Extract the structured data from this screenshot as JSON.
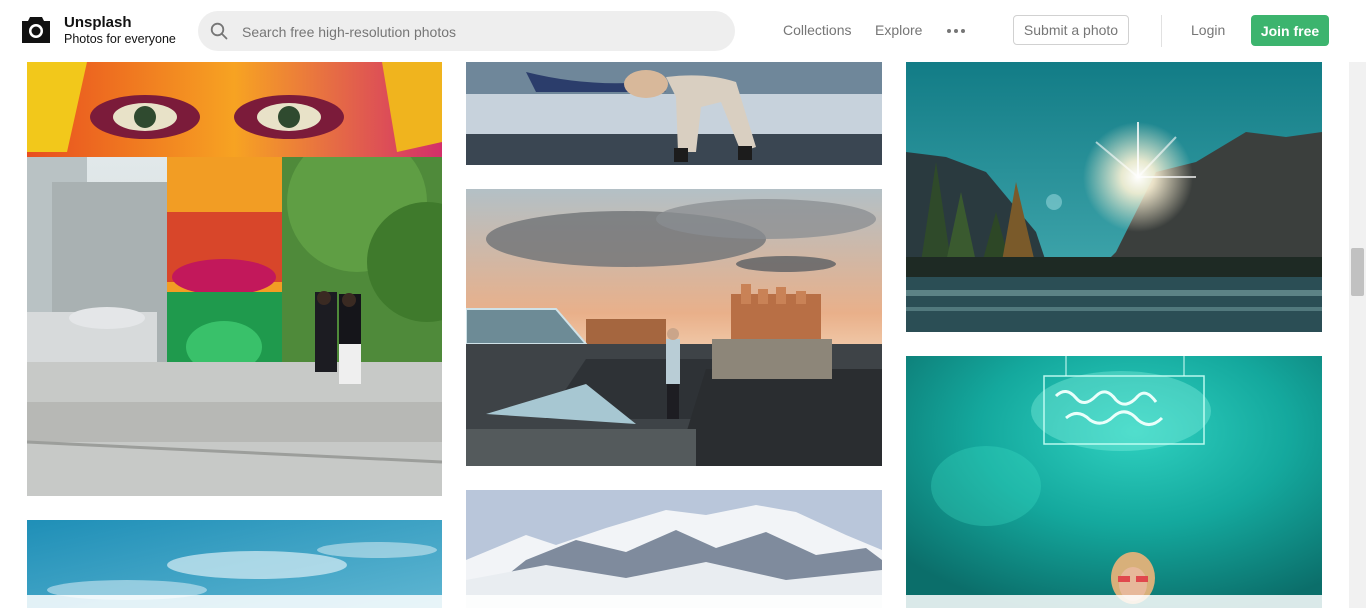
{
  "brand": {
    "name": "Unsplash",
    "tagline": "Photos for everyone"
  },
  "search": {
    "placeholder": "Search free high-resolution photos",
    "value": ""
  },
  "nav": {
    "collections": "Collections",
    "explore": "Explore",
    "more_icon": "ellipsis-icon",
    "submit": "Submit a photo",
    "login": "Login",
    "join": "Join free"
  },
  "colors": {
    "accent": "#3cb46e",
    "search_bg": "#eeeeee",
    "nav_text": "#767676"
  },
  "photos": [
    {
      "subject": "street-mural"
    },
    {
      "subject": "sky-clouds"
    },
    {
      "subject": "people-on-bench"
    },
    {
      "subject": "rooftop-sunset"
    },
    {
      "subject": "snowy-mountains"
    },
    {
      "subject": "valley-sunburst"
    },
    {
      "subject": "neon-sign-portrait"
    }
  ]
}
